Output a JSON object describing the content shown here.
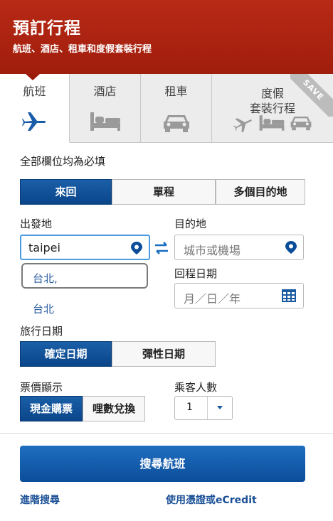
{
  "header": {
    "title": "預訂行程",
    "subtitle": "航班、酒店、租車和度假套裝行程"
  },
  "tabs": [
    {
      "label": "航班",
      "icon": "airplane-icon",
      "active": true
    },
    {
      "label": "酒店",
      "icon": "bed-icon"
    },
    {
      "label": "租車",
      "icon": "car-icon"
    },
    {
      "label_line1": "度假",
      "label_line2": "套裝行程",
      "badge": "SAVE"
    }
  ],
  "form": {
    "required_note": "全部欄位均為必填",
    "trip_type": [
      "來回",
      "單程",
      "多個目的地"
    ],
    "origin_label": "出發地",
    "origin_value": "taipei",
    "destination_label": "目的地",
    "destination_placeholder": "城市或機場",
    "suggestions": [
      "台北,",
      "台北"
    ],
    "return_date_label": "回程日期",
    "return_date_placeholder": "月／日／年",
    "travel_dates_label": "旅行日期",
    "date_mode": [
      "確定日期",
      "彈性日期"
    ],
    "fare_display_label": "票價顯示",
    "fare_display": [
      "現金購票",
      "哩數兌換"
    ],
    "passengers_label": "乘客人數",
    "passengers_value": "1",
    "search_button": "搜尋航班",
    "advanced_search": "進階搜尋",
    "use_certificate": "使用憑證或eCredit"
  },
  "colors": {
    "header_red": "#a81f0e",
    "primary_blue": "#0b4d99",
    "link_blue": "#1a4f96"
  }
}
